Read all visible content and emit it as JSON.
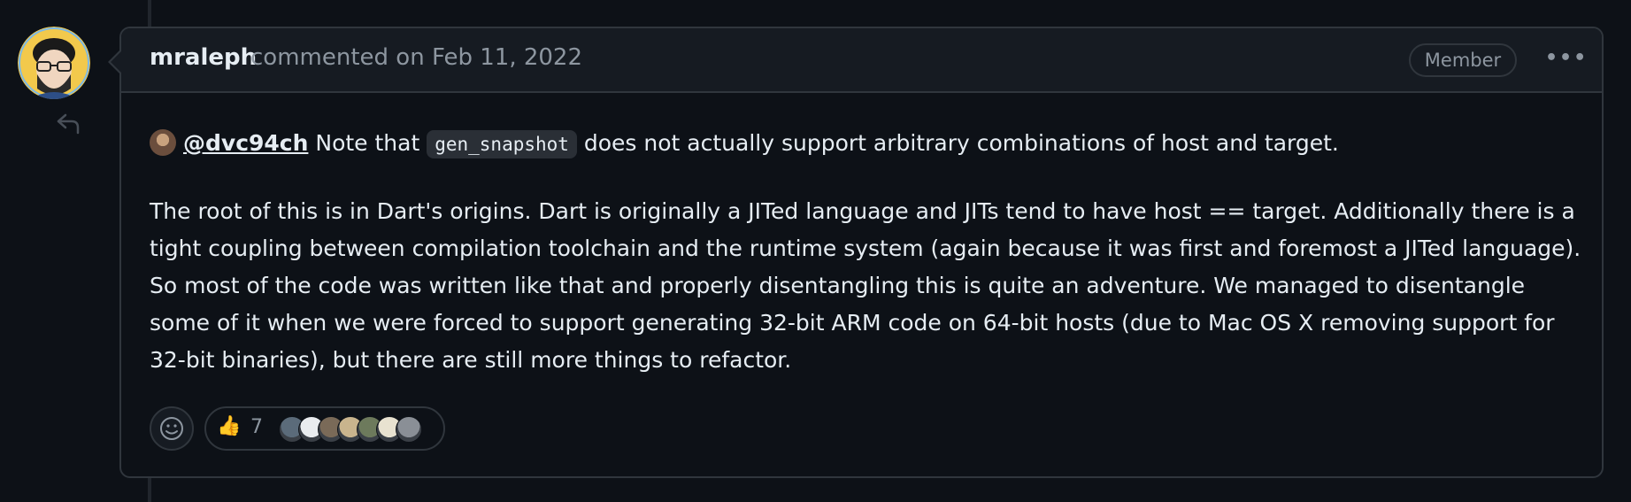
{
  "comment": {
    "author": "mraleph",
    "meta": "commented on Feb 11, 2022",
    "badge": "Member",
    "more": "•••",
    "mention": "@dvc94ch",
    "line1_prefix": " Note that ",
    "code": "gen_snapshot",
    "line1_suffix": " does not actually support arbitrary combinations of host and target.",
    "paragraph": "The root of this is in Dart's origins. Dart is originally a JITed language and JITs tend to have host == target. Additionally there is a tight coupling between compilation toolchain and the runtime system (again because it was first and foremost a JITed language). So most of the code was written like that and properly disentangling this is quite an adventure. We managed to disentangle some of it when we were forced to support generating 32-bit ARM code on 64-bit hosts (due to Mac OS X removing support for 32-bit binaries), but there are still more things to refactor."
  },
  "reactions": {
    "emoji": "👍",
    "count": "7",
    "reactor_colors": [
      "#5b6b7a",
      "#e9ecef",
      "#7a6a58",
      "#c9b48d",
      "#6d7a5c",
      "#e8e2d0",
      "#8a8f96"
    ]
  }
}
